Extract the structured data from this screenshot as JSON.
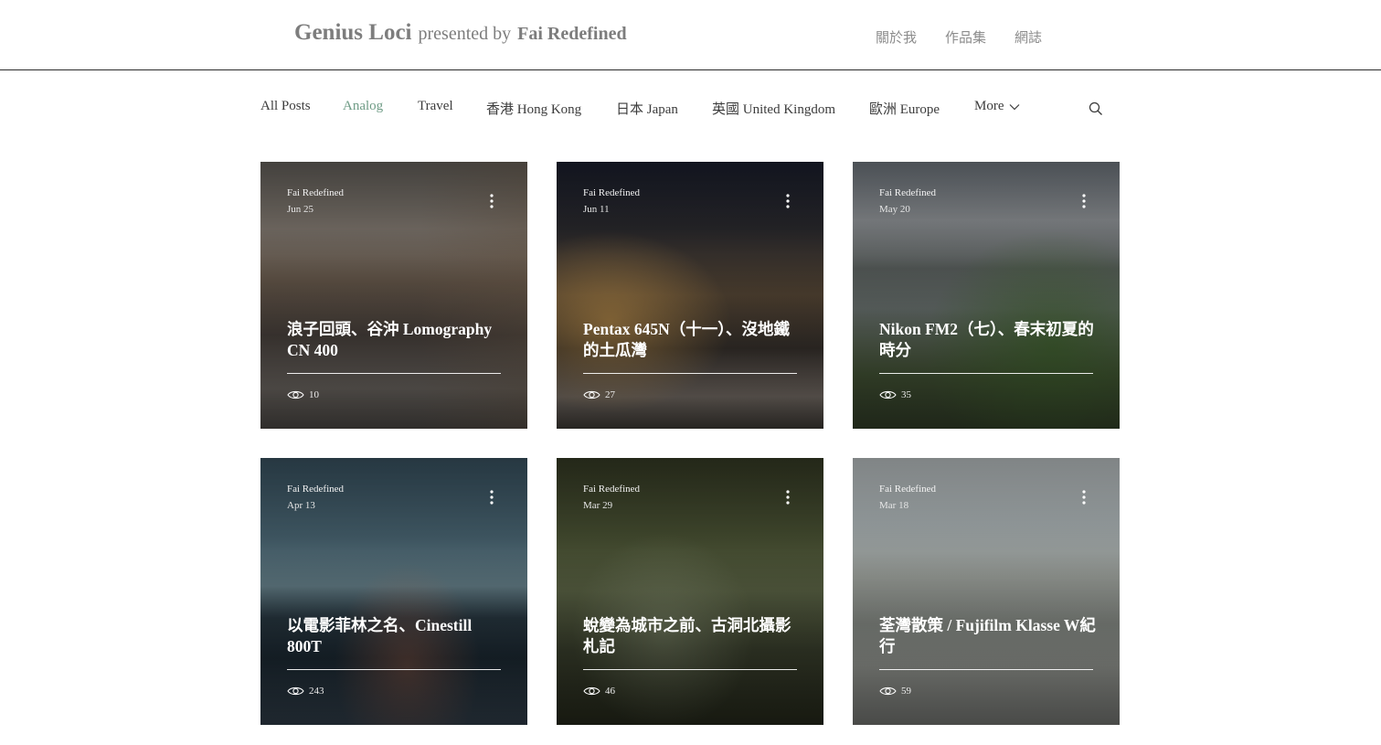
{
  "header": {
    "brand": "Genius Loci",
    "presented_by": "presented by",
    "author": "Fai Redefined",
    "nav": [
      "關於我",
      "作品集",
      "網誌"
    ]
  },
  "categories": {
    "items": [
      "All Posts",
      "Analog",
      "Travel",
      "香港 Hong Kong",
      "日本 Japan",
      "英國 United Kingdom",
      "歐洲 Europe"
    ],
    "active": "Analog",
    "more_label": "More"
  },
  "icons": {
    "search": "search-icon",
    "more_chevron": "chevron-down-icon",
    "post_menu": "more-vertical-icon",
    "views": "eye-icon"
  },
  "colors": {
    "active_category": "#6f9c86",
    "nav_text": "#8c8c8c",
    "title_text": "#7d7d7d"
  },
  "posts": [
    {
      "author": "Fai Redefined",
      "date": "Jun 25",
      "title": "浪子回頭、谷沖 Lomography CN 400",
      "views": "10"
    },
    {
      "author": "Fai Redefined",
      "date": "Jun 11",
      "title": "Pentax 645N（十一）、沒地鐵的土瓜灣",
      "views": "27"
    },
    {
      "author": "Fai Redefined",
      "date": "May 20",
      "title": "Nikon FM2（七）、春末初夏的時分",
      "views": "35"
    },
    {
      "author": "Fai Redefined",
      "date": "Apr 13",
      "title": "以電影菲林之名、Cinestill 800T",
      "views": "243"
    },
    {
      "author": "Fai Redefined",
      "date": "Mar 29",
      "title": "蛻變為城市之前、古洞北攝影札記",
      "views": "46"
    },
    {
      "author": "Fai Redefined",
      "date": "Mar 18",
      "title": "荃灣散策 / Fujifilm Klasse W紀行",
      "views": "59"
    }
  ]
}
